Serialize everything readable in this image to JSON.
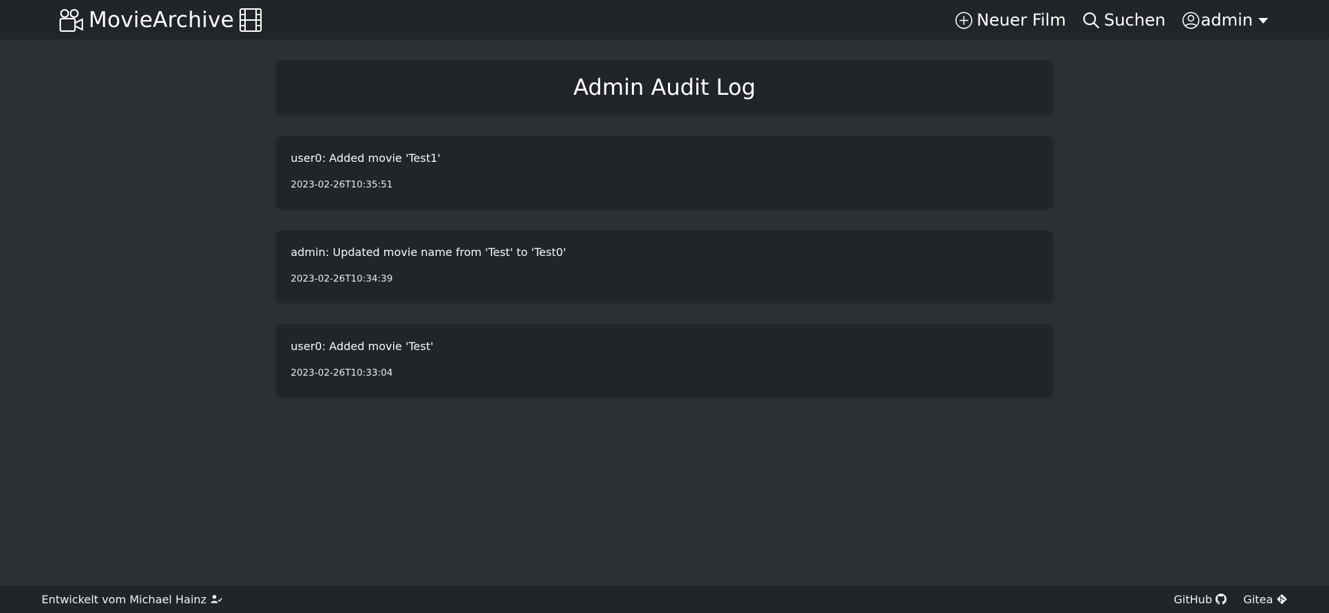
{
  "navbar": {
    "brand": {
      "label": "MovieArchive",
      "icons": [
        "camera-reels-icon",
        "film-icon"
      ]
    },
    "links": [
      {
        "label": "Neuer Film",
        "icon": "plus-circle-icon"
      },
      {
        "label": "Suchen",
        "icon": "search-icon"
      }
    ],
    "user_menu": {
      "label": "admin",
      "icon": "person-circle-icon"
    }
  },
  "main": {
    "title": "Admin Audit Log",
    "entries": [
      {
        "message": "user0: Added movie 'Test1'",
        "timestamp": "2023-02-26T10:35:51"
      },
      {
        "message": "admin: Updated movie name from 'Test' to 'Test0'",
        "timestamp": "2023-02-26T10:34:39"
      },
      {
        "message": "user0: Added movie 'Test'",
        "timestamp": "2023-02-26T10:33:04"
      }
    ]
  },
  "footer": {
    "credit": "Entwickelt vom Michael Hainz",
    "credit_icon": "person-check-icon",
    "links": [
      {
        "label": "GitHub",
        "icon": "github-icon"
      },
      {
        "label": "Gitea",
        "icon": "git-icon"
      }
    ]
  },
  "colors": {
    "background": "#2b3035",
    "surface": "#212529",
    "text": "#ffffff"
  }
}
